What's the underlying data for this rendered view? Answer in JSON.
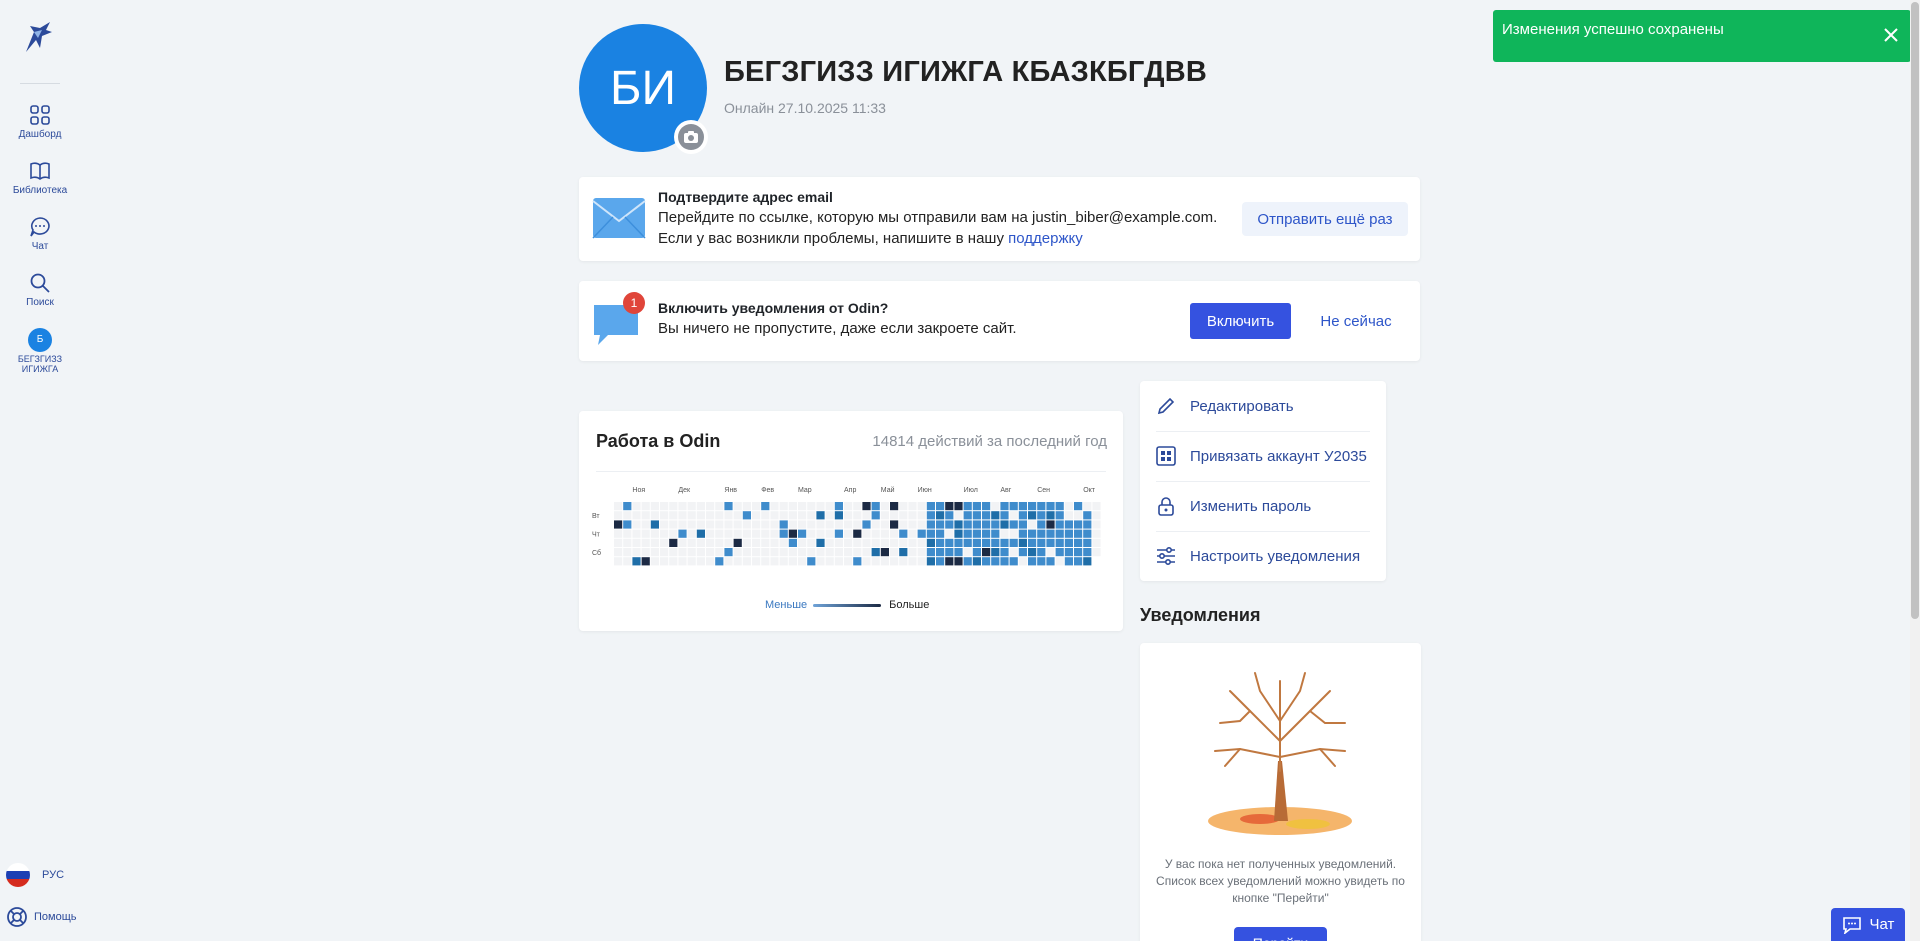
{
  "sidebar": {
    "items": [
      {
        "label": "Дашборд",
        "icon": "grid-icon"
      },
      {
        "label": "Библиотека",
        "icon": "book-icon"
      },
      {
        "label": "Чат",
        "icon": "chat-icon"
      },
      {
        "label": "Поиск",
        "icon": "search-icon"
      }
    ],
    "user": {
      "initial": "Б",
      "label": "БЕГЗГИЗЗ ИГИЖГА"
    },
    "language": "РУС",
    "help": "Помощь"
  },
  "profile": {
    "initials": "БИ",
    "name": "БЕГЗГИЗЗ ИГИЖГА КБАЗКБГДВВ",
    "status": "Онлайн 27.10.2025 11:33"
  },
  "email_card": {
    "title": "Подтвердите адрес email",
    "line1": "Перейдите по ссылке, которую мы отправили вам на justin_biber@example.com.",
    "line2_prefix": "Если у вас возникли проблемы, напишите в нашу ",
    "line2_link": "поддержку",
    "resend_label": "Отправить ещё раз"
  },
  "notifications_card": {
    "title": "Включить уведомления от Odin?",
    "subtitle": "Вы ничего не пропустите, даже если закроете сайт.",
    "badge": "1",
    "enable_label": "Включить",
    "later_label": "Не сейчас"
  },
  "activity": {
    "title": "Работа в Odin",
    "count_text": "14814 действий за последний год",
    "months": [
      "Ноя",
      "Дек",
      "Янв",
      "Фев",
      "Мар",
      "Апр",
      "Май",
      "Июн",
      "Июл",
      "Авг",
      "Сен",
      "Окт"
    ],
    "weekday_labels": [
      "Вт",
      "Чт",
      "Сб"
    ],
    "legend_less": "Меньше",
    "legend_more": "Больше"
  },
  "actions": [
    {
      "label": "Редактировать",
      "icon": "pencil-icon"
    },
    {
      "label": "Привязать аккаунт У2035",
      "icon": "u2035-icon"
    },
    {
      "label": "Изменить пароль",
      "icon": "lock-icon"
    },
    {
      "label": "Настроить уведомления",
      "icon": "sliders-icon"
    }
  ],
  "notifications_section": {
    "title": "Уведомления",
    "empty_text": "У вас пока нет полученных уведомлений. Список всех уведомлений можно увидеть по кнопке \"Перейти\"",
    "go_label": "Перейти"
  },
  "toast": {
    "text": "Изменения успешно сохранены"
  },
  "chat_button": {
    "label": "Чат"
  },
  "colors": {
    "accent": "#3552e0",
    "avatar": "#1a82e2",
    "toast": "#0fb55a",
    "link": "#2e56c9"
  }
}
